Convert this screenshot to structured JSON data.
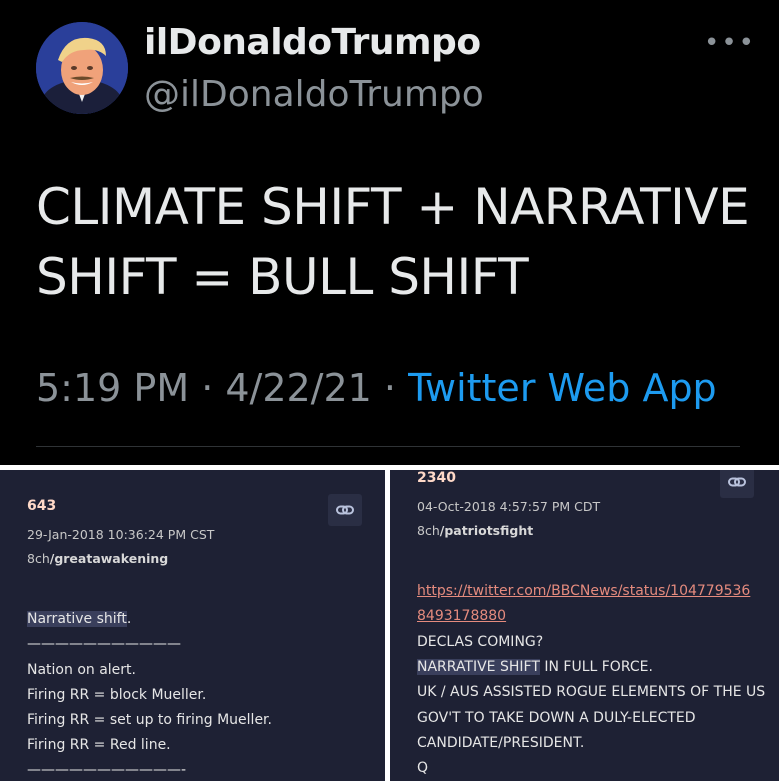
{
  "tweet": {
    "display_name": "ilDonaldoTrumpo",
    "handle": "@ilDonaldoTrumpo",
    "more_glyph": "•••",
    "text": "CLIMATE SHIFT + NARRATIVE SHIFT = BULL SHIFT",
    "time": "5:19 PM · 4/22/21 · ",
    "source": "Twitter Web App",
    "colors": {
      "background": "#000000",
      "text": "#e7e9ea",
      "muted": "#8b9298",
      "link": "#1d9bf0"
    }
  },
  "post_left": {
    "number": "643",
    "date": "29-Jan-2018 10:36:24 PM CST",
    "board_prefix": "8ch",
    "board_name": "/greatawakening",
    "lines": {
      "l1_highlight": "Narrative shift",
      "l1_rest": ".",
      "l2": "———————————",
      "l3": "Nation on alert.",
      "l4": "Firing RR = block Mueller.",
      "l5": "Firing RR = set up to firing Mueller.",
      "l6": "Firing RR = Red line.",
      "l7": "———————————-"
    }
  },
  "post_right": {
    "number": "2340",
    "date": "04-Oct-2018 4:57:57 PM CDT",
    "board_prefix": "8ch",
    "board_name": "/patriotsfight",
    "url_line1": "https://twitter.com/BBCNews/status/104779536",
    "url_line2": "8493178880",
    "lines": {
      "l1": "DECLAS COMING?",
      "l2_highlight": "NARRATIVE SHIFT",
      "l2_rest": " IN FULL FORCE.",
      "l3": "UK / AUS ASSISTED ROGUE ELEMENTS OF THE US",
      "l4": "GOV'T TO TAKE DOWN A DULY-ELECTED",
      "l5": "CANDIDATE/PRESIDENT.",
      "l6": "Q"
    }
  },
  "icons": [
    "link-icon",
    "more-icon"
  ],
  "colors": {
    "post_background": "#1e2134",
    "post_number": "#ffd9c8",
    "url": "#e58b7e",
    "highlight": "#3a3f5c"
  }
}
